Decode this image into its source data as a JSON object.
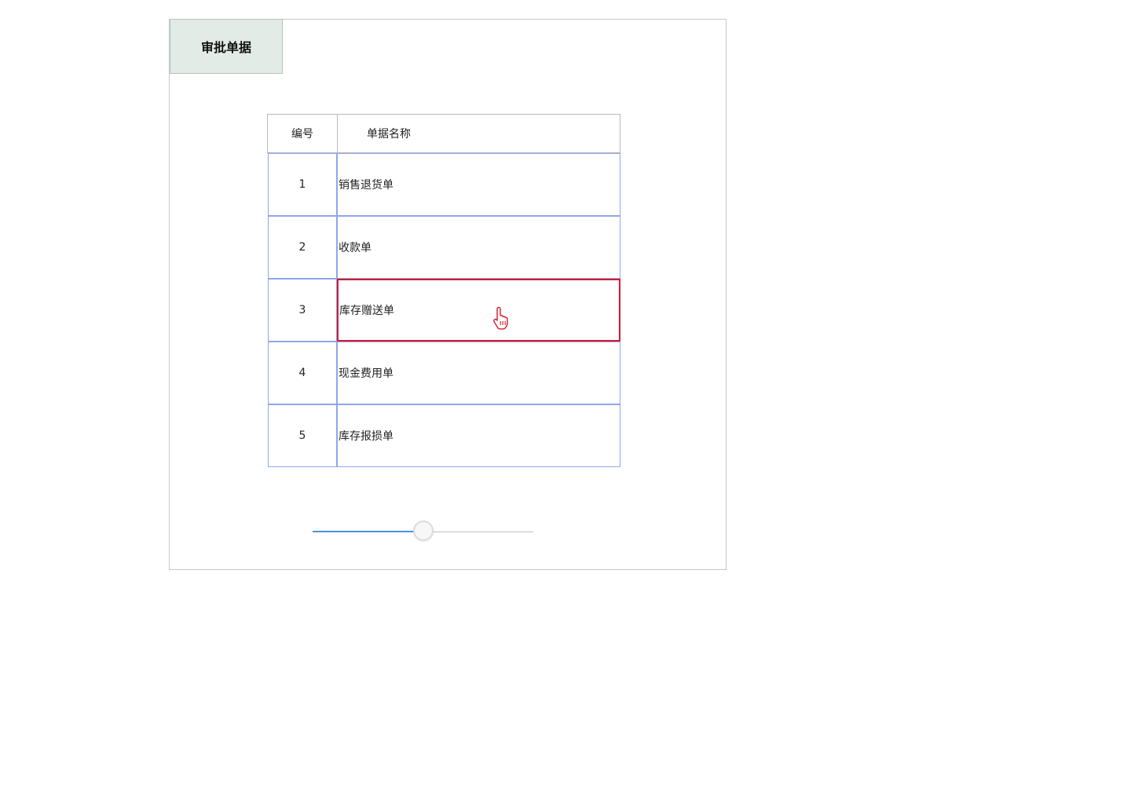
{
  "panel": {
    "tab_label": "审批单据"
  },
  "table": {
    "headers": {
      "no": "编号",
      "name": "单据名称"
    },
    "rows": [
      {
        "no": "1",
        "name": "销售退货单"
      },
      {
        "no": "2",
        "name": "收款单"
      },
      {
        "no": "3",
        "name": "库存赠送单"
      },
      {
        "no": "4",
        "name": "现金费用单"
      },
      {
        "no": "5",
        "name": "库存报损单"
      }
    ],
    "selected_row": 3
  },
  "slider": {
    "value_fraction": 0.5
  },
  "icons": {
    "cursor": "hand-pointer-icon"
  },
  "colors": {
    "tab_background": "#e2ebe5",
    "cell_border": "#8fa5ee",
    "selected_border": "#d9182b",
    "slider_fill": "#4a90e2"
  }
}
